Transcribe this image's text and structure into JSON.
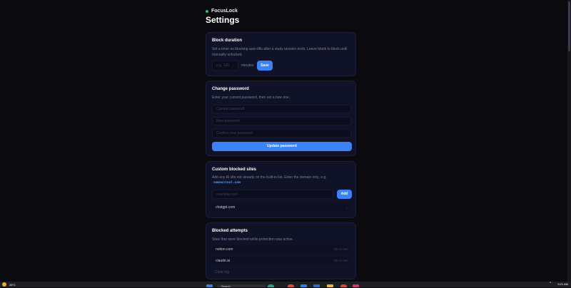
{
  "app": {
    "name": "FocusLock",
    "status_color": "#22c55e",
    "accent": "#3b82f6"
  },
  "page": {
    "title": "Settings"
  },
  "block_duration": {
    "title": "Block duration",
    "description": "Set a timer so blocking auto-lifts after a study session ends. Leave blank to block until manually unlocked.",
    "input_placeholder": "e.g. 120",
    "unit": "minutes",
    "save_label": "Save"
  },
  "change_password": {
    "title": "Change password",
    "description": "Enter your current password, then set a new one.",
    "current_placeholder": "Current password",
    "new_placeholder": "New password",
    "confirm_placeholder": "Confirm new password",
    "submit_label": "Update password"
  },
  "custom_sites": {
    "title": "Custom blocked sites",
    "description": "Add any AI site not already on the built-in list. Enter the domain only, e.g.",
    "example": "someaitool.com",
    "input_placeholder": "example.com",
    "add_label": "Add",
    "sites": [
      {
        "domain": "chatgpt.com",
        "remove": "×"
      }
    ]
  },
  "blocked_attempts": {
    "title": "Blocked attempts",
    "description": "Sites that were blocked while protection was active.",
    "attempts": [
      {
        "domain": "notion.com",
        "time": "09:21 AM"
      },
      {
        "domain": "claude.ai",
        "time": "09:21 AM"
      }
    ],
    "clear_label": "Clear log"
  },
  "taskbar": {
    "temperature": "28°C",
    "search_label": "Search",
    "clock": "9:21 AM",
    "pinned_icons": [
      "browser-icon",
      "chrome-icon",
      "vscode-icon",
      "store-icon",
      "file-explorer-icon",
      "app-icon",
      "media-icon"
    ]
  }
}
